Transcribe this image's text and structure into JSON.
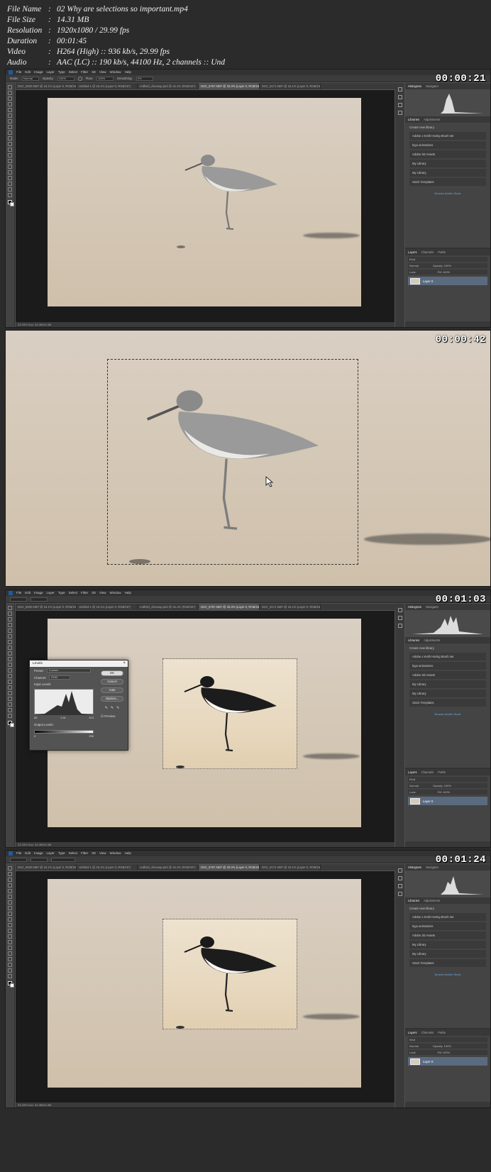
{
  "info": [
    {
      "key": "File Name",
      "value": "02 Why are selections so important.mp4"
    },
    {
      "key": "File Size",
      "value": "14.31 MB"
    },
    {
      "key": "Resolution",
      "value": "1920x1080 / 29.99 fps"
    },
    {
      "key": "Duration",
      "value": "00:01:45"
    },
    {
      "key": "Video",
      "value": "H264 (High) :: 936 kb/s, 29.99 fps"
    },
    {
      "key": "Audio",
      "value": "AAC (LC) :: 190 kb/s, 44100 Hz, 2 channels :: Und"
    }
  ],
  "separator": ":",
  "frames": [
    {
      "timestamp": "00:00:21"
    },
    {
      "timestamp": "00:00:42"
    },
    {
      "timestamp": "00:01:03"
    },
    {
      "timestamp": "00:01:24"
    }
  ],
  "ps": {
    "menu": [
      "File",
      "Edit",
      "Image",
      "Layer",
      "Type",
      "Select",
      "Filter",
      "3D",
      "View",
      "Window",
      "Help"
    ],
    "options": {
      "mode_label": "Mode:",
      "mode_value": "Normal",
      "opacity_label": "Opacity:",
      "opacity_value": "100%",
      "flow_label": "Flow:",
      "flow_value": "100%",
      "smoothing_label": "Smoothing:",
      "smoothing_value": "0%"
    },
    "tabs": [
      "DSC_9020.NEF @ 15.1% (Layer 0, RGB/16*)",
      "Untitled-1 @ 15.1% (Layer 0, RGB/16*)",
      "redfield_clinanap.psd @ 15.1% (RGB/16*)",
      "DSC_5767.NEF @ 33.3% (Layer 0, RGB/16*)",
      "DSC_9171.NEF @ 15.1% (Layer 0, RGB/16*)"
    ],
    "status": "33.33%   Doc: 34.3M/34.3M",
    "panel_tabs": {
      "histogram": "Histogram",
      "navigator": "Navigator",
      "libraries": "Libraries",
      "adjustments": "Adjustments",
      "layers": "Layers",
      "channels": "Channels",
      "paths": "Paths"
    },
    "libraries": {
      "header": "Create new library",
      "items": [
        "Adobe x Keith Haring Brush set",
        "logo animations",
        "Adobe 3D Assets",
        "My Library",
        "My Library",
        "Stock Templates"
      ],
      "link": "Browse Adobe Stock"
    },
    "layers": {
      "kind": "Kind",
      "blend": "Normal",
      "opacity": "Opacity: 100%",
      "lock": "Lock:",
      "fill": "Fill: 100%",
      "layer_name": "Layer 0"
    }
  },
  "levels": {
    "title": "Levels",
    "preset_label": "Preset:",
    "preset_value": "Custom",
    "channel_label": "Channel:",
    "channel_value": "RGB",
    "input_label": "Input Levels:",
    "input_values": [
      "85",
      "1.91",
      "213"
    ],
    "output_label": "Output Levels:",
    "output_values": [
      "0",
      "255"
    ],
    "buttons": {
      "ok": "OK",
      "cancel": "Cancel",
      "auto": "Auto",
      "options": "Options..."
    },
    "preview_label": "Preview"
  }
}
